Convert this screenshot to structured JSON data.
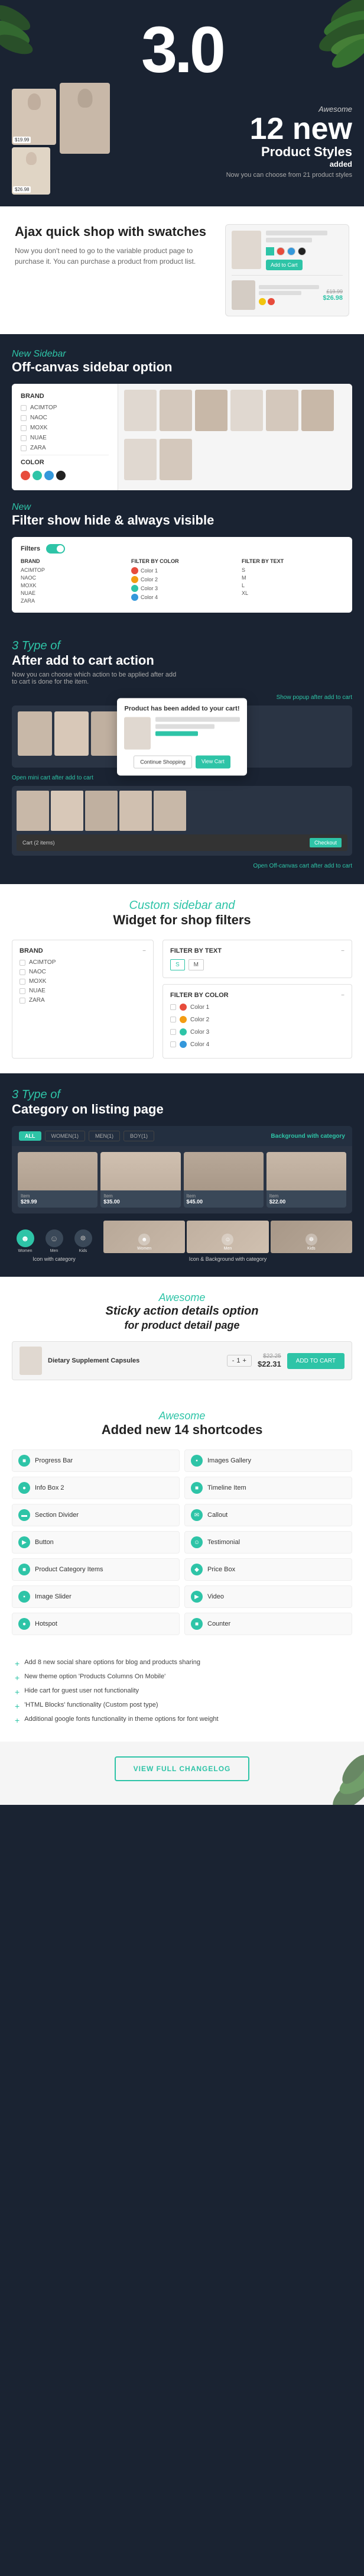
{
  "hero": {
    "version": "3.0",
    "awesome_label": "Awesome",
    "product_count": "12 new",
    "product_label": "Product Styles",
    "product_added": "added",
    "product_sub": "Now you can choose from 21 product styles"
  },
  "ajax_section": {
    "title": "Ajax quick shop with swatches",
    "desc": "Now you don't need to go to the variable product page to purchase it. You can purchase a product from product list.",
    "price1": "£19.99",
    "price2": "$26.98"
  },
  "sidebar_section": {
    "tag": "New Sidebar",
    "title": "Off-canvas sidebar option"
  },
  "filter_section": {
    "tag": "New",
    "title": "Filter show hide & always visible",
    "filter_label": "Filters",
    "brand_label": "BRAND",
    "color_label": "FILTER BY COLOR",
    "text_label": "FILTER BY TEXT",
    "brands": [
      "ACIMTOP",
      "NAOC",
      "MOXK",
      "NUAE",
      "ZARA"
    ],
    "colors": [
      "Color 1",
      "Color 2",
      "Color 3",
      "Color 4"
    ]
  },
  "after_cart_section": {
    "tag": "3 Type of",
    "title": "After add to cart action",
    "desc": "Now you can choose which action to be applied after add to cart is done for the item.",
    "popup_label": "Show popup after add to cart",
    "popup_title": "Product has been added to your cart!",
    "btn_continue": "Continue Shopping",
    "btn_view": "View Cart",
    "mini_cart_label": "Open mini cart after add to cart",
    "offcanvas_label": "Open Off-canvas cart after add to cart"
  },
  "custom_sidebar_section": {
    "tag": "Custom sidebar and",
    "title": "Widget for shop filters",
    "brand_title": "BRAND",
    "filter_text_title": "FILTER BY TEXT",
    "filter_color_title": "FILTER BY COLOR",
    "brands": [
      "ACIMTOP",
      "NAOC",
      "MOXK",
      "NUAE",
      "ZARA"
    ],
    "filter_text_items": [
      "S",
      "M"
    ],
    "colors": [
      {
        "name": "Color 1",
        "hex": "#e74c3c"
      },
      {
        "name": "Color 2",
        "hex": "#f39c12"
      },
      {
        "name": "Color 3",
        "hex": "#2ec4a7"
      },
      {
        "name": "Color 4",
        "hex": "#3498db"
      }
    ]
  },
  "category_section": {
    "tag": "3 Type of",
    "title": "Category on listing page",
    "tabs": [
      "ALL",
      "WOMEN(1)",
      "MEN(1)",
      "BOY(1)"
    ],
    "background_with_category": "Background with category",
    "type_icon": "Icon with category",
    "type_icon_bg": "Icon & Background with category"
  },
  "sticky_section": {
    "awesome_label": "Awesome",
    "title": "Sticky action details option",
    "subtitle": "for product detail page",
    "product_name": "Dietary Supplement Capsules",
    "old_price": "$22.25",
    "new_price": "$22.31",
    "qty": "1",
    "btn_label": "ADD TO CART"
  },
  "shortcodes_section": {
    "awesome_label": "Awesome",
    "title": "Added new 14 shortcodes",
    "items": [
      "Progress Bar",
      "Images Gallery",
      "Info Box 2",
      "Timeline Item",
      "Section Divider",
      "Callout",
      "Button",
      "Testimonial",
      "Product Category Items",
      "Price Box",
      "Image Slider",
      "Video",
      "Hotspot",
      "Counter"
    ]
  },
  "features_section": {
    "items": [
      "Add 8 new social share options for blog and products sharing",
      "New theme option 'Products Columns On Mobile'",
      "Hide cart for guest user not functionality",
      "'HTML Blocks' functionality (Custom post type)",
      "Additional google fonts functionality in theme options for font weight"
    ]
  },
  "changelog_section": {
    "btn_label": "VIEW FULL CHANGELOG"
  },
  "colors": {
    "green": "#2ec4a7",
    "dark": "#1a2332",
    "white": "#ffffff"
  }
}
